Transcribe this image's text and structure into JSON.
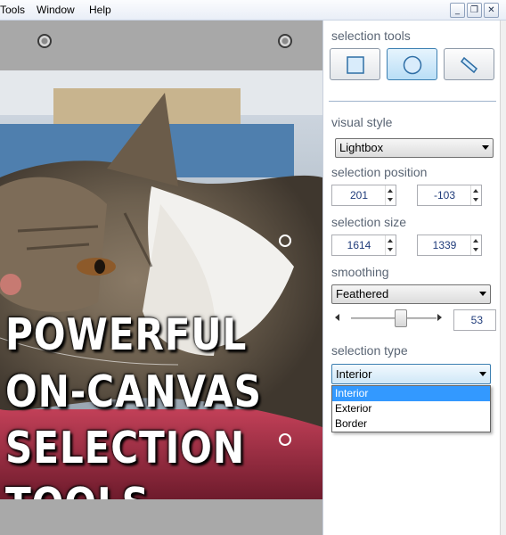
{
  "menu": {
    "items": [
      "Tools",
      "Window",
      "Help"
    ],
    "window_controls": [
      "minimize-icon",
      "restore-icon",
      "close-icon"
    ],
    "minimize_glyph": "_",
    "restore_glyph": "❐",
    "close_glyph": "✕"
  },
  "canvas": {
    "overlay_lines": [
      "POWERFUL",
      "ON-CANVAS",
      "SELECTION",
      "TOOLS"
    ]
  },
  "panel": {
    "selection_tools": {
      "label": "selection tools",
      "tools": [
        "rectangle-select-icon",
        "ellipse-select-icon",
        "lasso-select-icon"
      ],
      "active_tool": "ellipse-select-icon"
    },
    "visual_style": {
      "label": "visual style",
      "value": "Lightbox"
    },
    "selection_position": {
      "label": "selection position",
      "x": "201",
      "y": "-103"
    },
    "selection_size": {
      "label": "selection size",
      "width": "1614",
      "height": "1339"
    },
    "smoothing": {
      "label": "smoothing",
      "value": "Feathered",
      "slider_value": "53",
      "slider_fraction": 0.53
    },
    "selection_type": {
      "label": "selection type",
      "value": "Interior",
      "options": [
        "Interior",
        "Exterior",
        "Border"
      ],
      "selected_option": "Interior"
    }
  },
  "colors": {
    "accent": "#3399ff",
    "active_tool_bg": "#b9def6",
    "section_label": "#5a6574",
    "value_text": "#1f3b7a"
  }
}
